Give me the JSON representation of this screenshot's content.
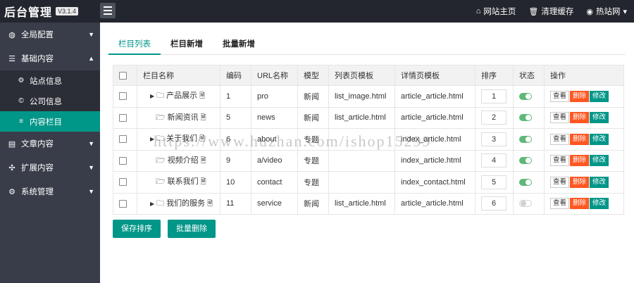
{
  "header": {
    "title": "后台管理",
    "version": "V3.1.4",
    "links": [
      {
        "icon": "home-icon",
        "label": "网站主页"
      },
      {
        "icon": "trash-icon",
        "label": "清理缓存"
      },
      {
        "icon": "user-icon",
        "label": "热站网"
      }
    ]
  },
  "sidebar": {
    "items": [
      {
        "label": "全局配置"
      },
      {
        "label": "基础内容",
        "children": [
          {
            "label": "站点信息"
          },
          {
            "label": "公司信息"
          },
          {
            "label": "内容栏目"
          }
        ]
      },
      {
        "label": "文章内容"
      },
      {
        "label": "扩展内容"
      },
      {
        "label": "系统管理"
      }
    ]
  },
  "tabs": [
    "栏目列表",
    "栏目新增",
    "批量新增"
  ],
  "table": {
    "headers": [
      "栏目名称",
      "编码",
      "URL名称",
      "模型",
      "列表页模板",
      "详情页模板",
      "排序",
      "状态",
      "操作"
    ],
    "rows": [
      {
        "name": "产品展示",
        "code": "1",
        "url": "pro",
        "model": "新闻",
        "list_tpl": "list_image.html",
        "detail_tpl": "article_article.html",
        "order": "1"
      },
      {
        "name": "新闻资讯",
        "code": "5",
        "url": "news",
        "model": "新闻",
        "list_tpl": "list_article.html",
        "detail_tpl": "article_article.html",
        "order": "2"
      },
      {
        "name": "关于我们",
        "code": "6",
        "url": "about",
        "model": "专题",
        "list_tpl": "",
        "detail_tpl": "index_article.html",
        "order": "3"
      },
      {
        "name": "视频介绍",
        "code": "9",
        "url": "a/video",
        "model": "专题",
        "list_tpl": "",
        "detail_tpl": "index_article.html",
        "order": "4"
      },
      {
        "name": "联系我们",
        "code": "10",
        "url": "contact",
        "model": "专题",
        "list_tpl": "",
        "detail_tpl": "index_contact.html",
        "order": "5"
      },
      {
        "name": "我们的服务",
        "code": "11",
        "url": "service",
        "model": "新闻",
        "list_tpl": "list_article.html",
        "detail_tpl": "article_article.html",
        "order": "6"
      }
    ],
    "actions": {
      "view": "查看",
      "delete": "删除",
      "edit": "修改"
    }
  },
  "buttons": {
    "save_order": "保存排序",
    "batch_delete": "批量删除"
  },
  "watermark": "https://www.huzhan.com/ishop15299",
  "colors": {
    "accent": "#009688",
    "danger": "#ff5722",
    "sidebar": "#393d49",
    "topbar": "#23262e"
  }
}
